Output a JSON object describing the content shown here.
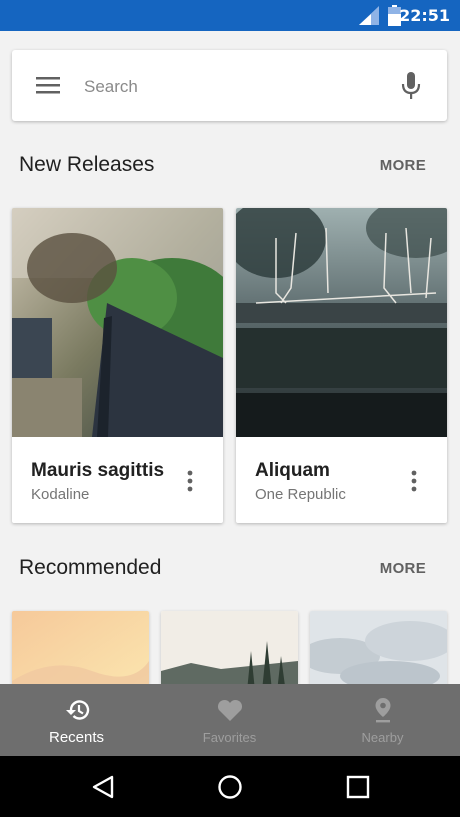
{
  "status_bar": {
    "time": "22:51"
  },
  "search": {
    "placeholder": "Search"
  },
  "sections": {
    "new_releases": {
      "title": "New Releases",
      "more": "MORE"
    },
    "recommended": {
      "title": "Recommended",
      "more": "MORE"
    }
  },
  "cards": [
    {
      "title": "Mauris sagittis",
      "artist": "Kodaline"
    },
    {
      "title": "Aliquam",
      "artist": "One Republic"
    }
  ],
  "bottom_nav": {
    "items": [
      {
        "label": "Recents",
        "icon": "history-icon",
        "active": true
      },
      {
        "label": "Favorites",
        "icon": "heart-icon",
        "active": false
      },
      {
        "label": "Nearby",
        "icon": "location-pin-icon",
        "active": false
      }
    ]
  },
  "colors": {
    "status_bar": "#1565c0",
    "nav_bg": "#6e6e6e",
    "background": "#f2f2f2"
  }
}
